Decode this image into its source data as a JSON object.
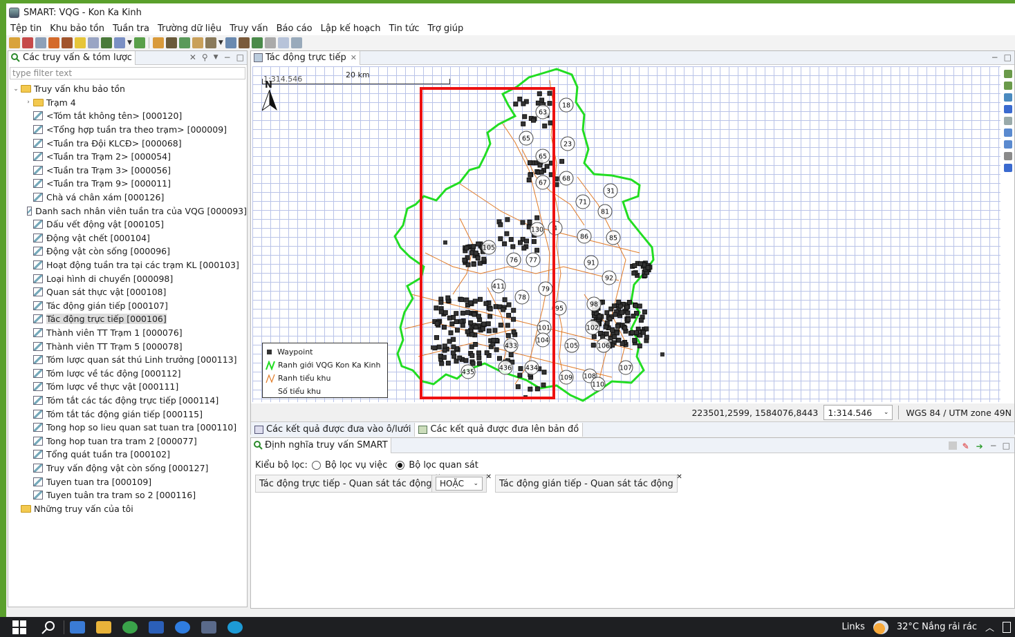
{
  "window": {
    "title": "SMART: VQG - Kon Ka Kinh"
  },
  "menu": [
    "Tệp tin",
    "Khu bảo tồn",
    "Tuần tra",
    "Trường dữ liệu",
    "Truy vấn",
    "Báo cáo",
    "Lập kế hoạch",
    "Tin tức",
    "Trợ giúp"
  ],
  "left_panel": {
    "tab_label": "Các truy vấn & tóm lược",
    "filter_placeholder": "type filter text",
    "root": "Truy vấn khu bảo tồn",
    "items": [
      {
        "label": "Trạm 4",
        "kind": "folder",
        "level": 1,
        "twisty": "›"
      },
      {
        "label": "<Tóm tắt không tên> [000120]",
        "kind": "query",
        "level": 1
      },
      {
        "label": "<Tổng hợp tuần tra theo trạm> [000009]",
        "kind": "query",
        "level": 1
      },
      {
        "label": "<Tuần tra Đội KLCĐ> [000068]",
        "kind": "query",
        "level": 1
      },
      {
        "label": "<Tuần tra Trạm 2> [000054]",
        "kind": "query",
        "level": 1
      },
      {
        "label": "<Tuần tra Trạm 3> [000056]",
        "kind": "query",
        "level": 1
      },
      {
        "label": "<Tuần tra Trạm 9> [000011]",
        "kind": "query",
        "level": 1
      },
      {
        "label": "Chà vá chân xám [000126]",
        "kind": "query",
        "level": 1
      },
      {
        "label": "Danh sach nhân viên tuần tra của VQG [000093]",
        "kind": "query",
        "level": 1
      },
      {
        "label": "Dấu vết động vật [000105]",
        "kind": "query",
        "level": 1
      },
      {
        "label": "Động vật chết [000104]",
        "kind": "query",
        "level": 1
      },
      {
        "label": "Động vật còn sống [000096]",
        "kind": "query",
        "level": 1
      },
      {
        "label": "Hoạt động tuần tra tại các trạm KL [000103]",
        "kind": "query",
        "level": 1
      },
      {
        "label": "Loại hình di chuyển [000098]",
        "kind": "query",
        "level": 1
      },
      {
        "label": "Quan sát thực vật [000108]",
        "kind": "query",
        "level": 1
      },
      {
        "label": "Tác động gián tiếp [000107]",
        "kind": "query",
        "level": 1
      },
      {
        "label": "Tác động trực tiếp [000106]",
        "kind": "query",
        "level": 1,
        "selected": true
      },
      {
        "label": "Thành viên TT Trạm 1 [000076]",
        "kind": "query",
        "level": 1
      },
      {
        "label": "Thành viên TT Trạm 5 [000078]",
        "kind": "query",
        "level": 1
      },
      {
        "label": "Tóm lược quan sát thú Linh trưởng [000113]",
        "kind": "query",
        "level": 1
      },
      {
        "label": "Tóm lược về tác động [000112]",
        "kind": "query",
        "level": 1
      },
      {
        "label": "Tóm lược về thực vật [000111]",
        "kind": "query",
        "level": 1
      },
      {
        "label": "Tóm tắt các tác động trực tiếp [000114]",
        "kind": "query",
        "level": 1
      },
      {
        "label": "Tóm tắt tác động gián tiếp [000115]",
        "kind": "query",
        "level": 1
      },
      {
        "label": "Tong hop so lieu quan sat tuan tra [000110]",
        "kind": "query",
        "level": 1
      },
      {
        "label": "Tong hop tuan tra tram 2 [000077]",
        "kind": "query",
        "level": 1
      },
      {
        "label": "Tổng quát tuần tra [000102]",
        "kind": "query",
        "level": 1
      },
      {
        "label": "Truy vấn động vật còn sống [000127]",
        "kind": "query",
        "level": 1
      },
      {
        "label": "Tuyen tuan tra [000109]",
        "kind": "query",
        "level": 1
      },
      {
        "label": "Tuyen tuân tra tram so 2 [000116]",
        "kind": "query",
        "level": 1
      }
    ],
    "second_root": "Những truy vấn của tôi"
  },
  "map_panel": {
    "tab_label": "Tác động trực tiếp",
    "scale_bar_label": "20 km",
    "scale_number": "1:314.546",
    "north_label": "N",
    "legend": {
      "waypoint": "Waypoint",
      "boundary": "Ranh giới VQG Kon Ka Kinh",
      "subzone": "Ranh tiểu khu",
      "subzone_number": "Số tiểu khu"
    },
    "subzone_labels": [
      "63",
      "18",
      "65",
      "23",
      "65",
      "68",
      "31",
      "67",
      "71",
      "81",
      "4",
      "130",
      "86",
      "85",
      "105",
      "76",
      "77",
      "91",
      "92",
      "411",
      "78",
      "79",
      "95",
      "98",
      "101",
      "102",
      "104",
      "105",
      "106",
      "107",
      "108",
      "109",
      "110",
      "433",
      "434",
      "435",
      "436"
    ],
    "coordinates": "223501,2599, 1584076,8443",
    "scale_value": "1:314.546",
    "crs": "WGS 84 / UTM zone 49N",
    "colors": {
      "boundary": "#22dd22",
      "subzone": "#e07a26",
      "highlight": "#ee1111"
    }
  },
  "bottom_tabs": [
    "Các kết quả được đưa vào ô/lưới",
    "Các kết quả được đưa lên bản đồ"
  ],
  "query_panel": {
    "tab_label": "Định nghĩa truy vấn SMART",
    "filter_type_label": "Kiểu bộ lọc:",
    "option_incident": "Bộ lọc vụ việc",
    "option_observation": "Bộ lọc quan sát",
    "chip1": "Tác động trực tiếp - Quan sát tác động",
    "operator": "HOẶC",
    "chip2": "Tác động gián tiếp - Quan sát tác động"
  },
  "taskbar": {
    "links": "Links",
    "weather": "32°C Nắng rải rác"
  }
}
